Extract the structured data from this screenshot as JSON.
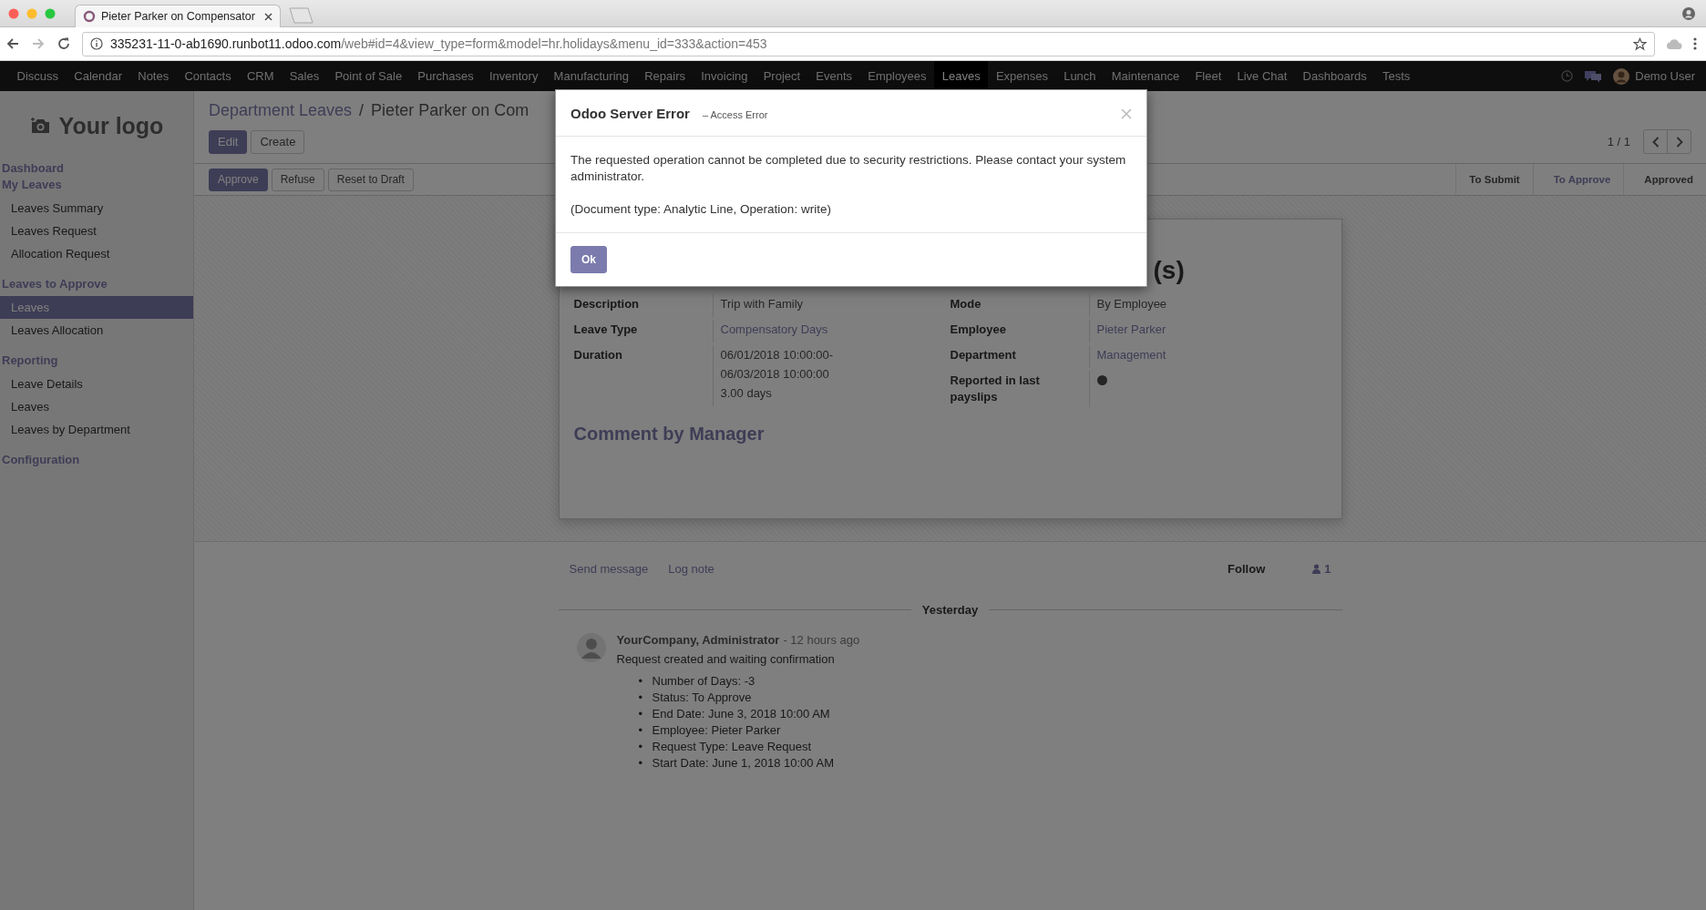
{
  "browser": {
    "tab": {
      "title": "Pieter Parker on Compensator"
    },
    "url": {
      "host": "335231-11-0-ab1690.runbot11.odoo.com",
      "path": "/web#id=4&view_type=form&model=hr.holidays&menu_id=333&action=453"
    }
  },
  "menu": {
    "items": [
      {
        "label": "Discuss",
        "selected": false
      },
      {
        "label": "Calendar",
        "selected": false
      },
      {
        "label": "Notes",
        "selected": false
      },
      {
        "label": "Contacts",
        "selected": false
      },
      {
        "label": "CRM",
        "selected": false
      },
      {
        "label": "Sales",
        "selected": false
      },
      {
        "label": "Point of Sale",
        "selected": false
      },
      {
        "label": "Purchases",
        "selected": false
      },
      {
        "label": "Inventory",
        "selected": false
      },
      {
        "label": "Manufacturing",
        "selected": false
      },
      {
        "label": "Repairs",
        "selected": false
      },
      {
        "label": "Invoicing",
        "selected": false
      },
      {
        "label": "Project",
        "selected": false
      },
      {
        "label": "Events",
        "selected": false
      },
      {
        "label": "Employees",
        "selected": false
      },
      {
        "label": "Leaves",
        "selected": true
      },
      {
        "label": "Expenses",
        "selected": false
      },
      {
        "label": "Lunch",
        "selected": false
      },
      {
        "label": "Maintenance",
        "selected": false
      },
      {
        "label": "Fleet",
        "selected": false
      },
      {
        "label": "Live Chat",
        "selected": false
      },
      {
        "label": "Dashboards",
        "selected": false
      },
      {
        "label": "Tests",
        "selected": false
      }
    ],
    "user": "Demo User"
  },
  "sidebar": {
    "logo": "Your logo",
    "sections": [
      {
        "label": "Dashboard"
      },
      {
        "label": "My Leaves",
        "items": [
          {
            "label": "Leaves Summary",
            "selected": false
          },
          {
            "label": "Leaves Request",
            "selected": false
          },
          {
            "label": "Allocation Request",
            "selected": false
          }
        ]
      },
      {
        "label": "Leaves to Approve",
        "items": [
          {
            "label": "Leaves",
            "selected": true
          },
          {
            "label": "Leaves Allocation",
            "selected": false
          }
        ]
      },
      {
        "label": "Reporting",
        "items": [
          {
            "label": "Leave Details",
            "selected": false
          },
          {
            "label": "Leaves",
            "selected": false
          },
          {
            "label": "Leaves by Department",
            "selected": false
          }
        ]
      },
      {
        "label": "Configuration"
      }
    ]
  },
  "control_panel": {
    "breadcrumb": [
      "Department Leaves",
      "Pieter Parker on Com"
    ],
    "separator": "/",
    "buttons": [
      {
        "label": "Edit",
        "kind": "primary"
      },
      {
        "label": "Create",
        "kind": "secondary"
      }
    ],
    "pager": "1 / 1"
  },
  "header": {
    "buttons": [
      {
        "label": "Approve",
        "kind": "primary"
      },
      {
        "label": "Refuse",
        "kind": "secondary"
      },
      {
        "label": "Reset to Draft",
        "kind": "secondary"
      }
    ],
    "statusbar": [
      {
        "label": "To Submit",
        "selected": false
      },
      {
        "label": "To Approve",
        "selected": true
      },
      {
        "label": "Approved",
        "selected": false
      }
    ]
  },
  "form": {
    "title": "(s)",
    "left_fields": [
      {
        "label": "Description",
        "kind": "text",
        "lines": [
          "Trip with Family"
        ]
      },
      {
        "label": "Leave Type",
        "kind": "link",
        "lines": [
          "Compensatory Days"
        ]
      },
      {
        "label": "Duration",
        "kind": "text",
        "lines": [
          "06/01/2018 10:00:00-",
          "06/03/2018 10:00:00",
          "3.00 days"
        ]
      }
    ],
    "right_fields": [
      {
        "label": "Mode",
        "kind": "text",
        "lines": [
          "By Employee"
        ]
      },
      {
        "label": "Employee",
        "kind": "link",
        "lines": [
          "Pieter Parker"
        ]
      },
      {
        "label": "Department",
        "kind": "link",
        "lines": [
          "Management"
        ]
      },
      {
        "label": "Reported in last payslips",
        "kind": "indicator",
        "on": false
      }
    ],
    "section_title": "Comment by Manager"
  },
  "chatter": {
    "send": "Send message",
    "log": "Log note",
    "follow": "Follow",
    "followers": "1",
    "date": "Yesterday",
    "messages": [
      {
        "author": "YourCompany, Administrator",
        "time": "- 12 hours ago",
        "body": "Request created and waiting confirmation",
        "bullet": "•",
        "changes": [
          "Number of Days: -3",
          "Status: To Approve",
          "End Date: June 3, 2018 10:00 AM",
          "Employee: Pieter Parker",
          "Request Type: Leave Request",
          "Start Date: June 1, 2018 10:00 AM"
        ]
      }
    ]
  },
  "dialog": {
    "title": "Odoo Server Error",
    "subtitle": "– Access Error",
    "message": "The requested operation cannot be completed due to security restrictions. Please contact your system administrator.",
    "details": "(Document type: Analytic Line, Operation: write)",
    "button": "Ok"
  }
}
